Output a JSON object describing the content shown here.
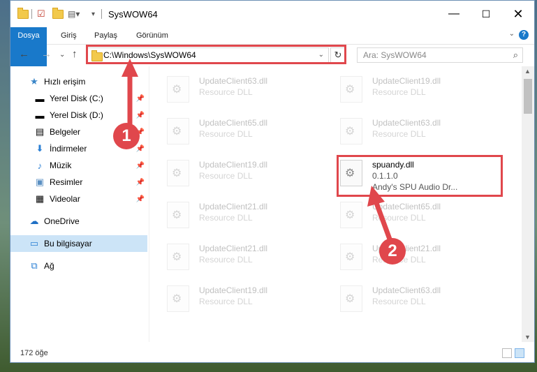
{
  "window": {
    "title": "SysWOW64"
  },
  "ribbon": {
    "tabs": [
      "Dosya",
      "Giriş",
      "Paylaş",
      "Görünüm"
    ]
  },
  "address": {
    "path": "C:\\Windows\\SysWOW64"
  },
  "search": {
    "placeholder": "Ara: SysWOW64"
  },
  "sidebar": {
    "items": [
      {
        "label": "Hızlı erişim",
        "icon": "star-icon",
        "pinned": false
      },
      {
        "label": "Yerel Disk (C:)",
        "icon": "drive-icon",
        "pinned": true
      },
      {
        "label": "Yerel Disk (D:)",
        "icon": "drive-icon",
        "pinned": true
      },
      {
        "label": "Belgeler",
        "icon": "documents-icon",
        "pinned": true
      },
      {
        "label": "İndirmeler",
        "icon": "download-icon",
        "pinned": true
      },
      {
        "label": "Müzik",
        "icon": "music-icon",
        "pinned": true
      },
      {
        "label": "Resimler",
        "icon": "pictures-icon",
        "pinned": true
      },
      {
        "label": "Videolar",
        "icon": "videos-icon",
        "pinned": true
      },
      {
        "label": "OneDrive",
        "icon": "cloud-icon",
        "pinned": false
      },
      {
        "label": "Bu bilgisayar",
        "icon": "computer-icon",
        "pinned": false,
        "selected": true
      },
      {
        "label": "Ağ",
        "icon": "network-icon",
        "pinned": false
      }
    ]
  },
  "files": {
    "left": [
      {
        "name": "UpdateClient63.dll",
        "type": "Resource DLL"
      },
      {
        "name": "UpdateClient65.dll",
        "type": "Resource DLL"
      },
      {
        "name": "UpdateClient19.dll",
        "type": "Resource DLL"
      },
      {
        "name": "UpdateClient21.dll",
        "type": "Resource DLL"
      },
      {
        "name": "UpdateClient21.dll",
        "type": "Resource DLL"
      },
      {
        "name": "UpdateClient19.dll",
        "type": "Resource DLL"
      }
    ],
    "right": [
      {
        "name": "UpdateClient19.dll",
        "type": "Resource DLL"
      },
      {
        "name": "UpdateClient63.dll",
        "type": "Resource DLL"
      },
      {
        "name": "spuandy.dll",
        "type": "0.1.1.0",
        "desc": "Andy's SPU Audio Dr...",
        "highlight": true
      },
      {
        "name": "UpdateClient65.dll",
        "type": "Resource DLL"
      },
      {
        "name": "UpdateClient21.dll",
        "type": "Resource DLL"
      },
      {
        "name": "UpdateClient63.dll",
        "type": "Resource DLL"
      }
    ]
  },
  "status": {
    "count": "172 öğe"
  },
  "annotations": {
    "badge1": "1",
    "badge2": "2",
    "color": "#e0474c"
  },
  "colors": {
    "accent": "#1979ca",
    "selection": "#cce4f7"
  }
}
